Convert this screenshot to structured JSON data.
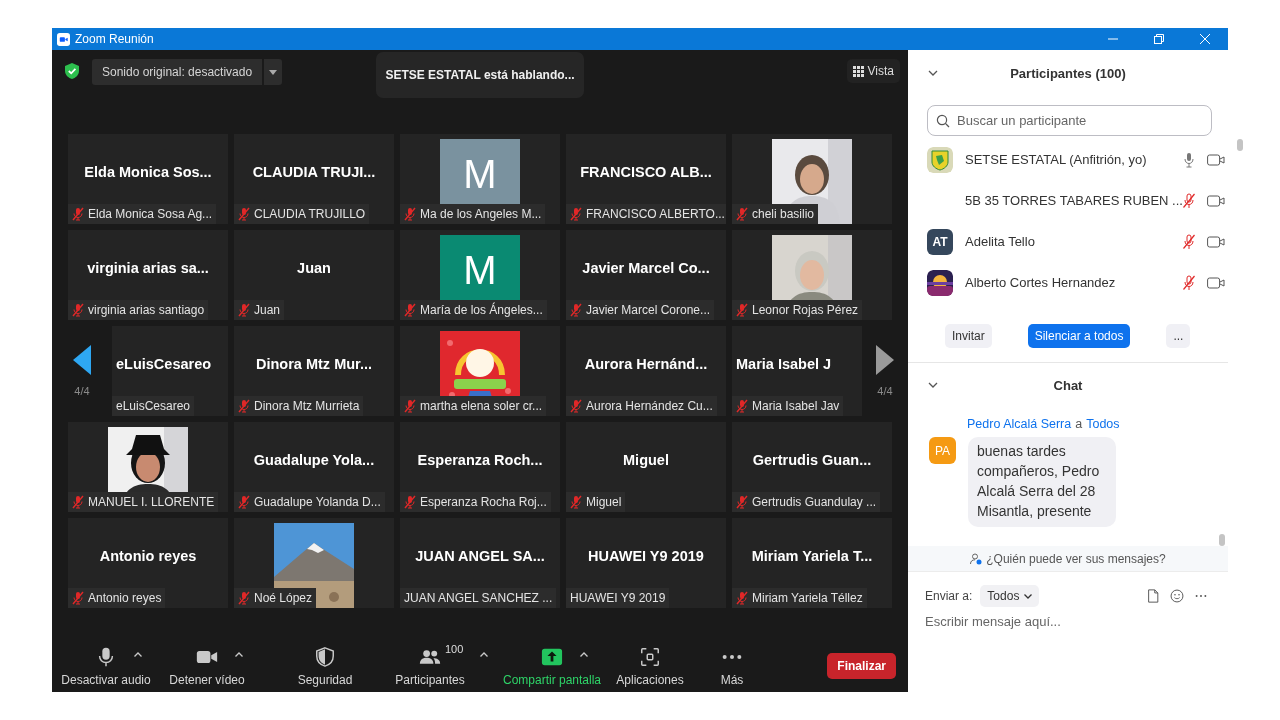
{
  "window": {
    "title": "Zoom Reunión"
  },
  "meeting": {
    "original_sound": "Sonido original: desactivado",
    "speaking": "SETSE ESTATAL está hablando...",
    "view": "Vista"
  },
  "gallery": {
    "prev_page": "4/4",
    "next_page": "4/4",
    "tiles": [
      {
        "kind": "name",
        "title": "Elda Monica Sos...",
        "label": "Elda Monica Sosa Ag...",
        "muted": true
      },
      {
        "kind": "name",
        "title": "CLAUDIA TRUJI...",
        "label": "CLAUDIA TRUJILLO",
        "muted": true
      },
      {
        "kind": "avatar",
        "letter": "M",
        "color": "#7a929f",
        "label": "Ma de los Angeles M...",
        "muted": true
      },
      {
        "kind": "name",
        "title": "FRANCISCO ALB...",
        "label": "FRANCISCO ALBERTO...",
        "muted": true
      },
      {
        "kind": "picture",
        "label": "cheli basilio",
        "muted": true
      },
      {
        "kind": "name",
        "title": "virginia arias sa...",
        "label": "virginia arias santiago",
        "muted": true
      },
      {
        "kind": "name",
        "title": "Juan",
        "label": "Juan",
        "muted": true
      },
      {
        "kind": "avatar",
        "letter": "M",
        "color": "#0a8a72",
        "label": "María de los Ángeles...",
        "muted": true
      },
      {
        "kind": "name",
        "title": "Javier Marcel Co...",
        "label": "Javier Marcel Corone...",
        "muted": true
      },
      {
        "kind": "picture",
        "label": "Leonor Rojas Pérez",
        "muted": true
      },
      {
        "kind": "name",
        "title": "eLuisCesareo",
        "label": "eLuisCesareo",
        "muted": false
      },
      {
        "kind": "name",
        "title": "Dinora Mtz Mur...",
        "label": "Dinora Mtz Murrieta",
        "muted": true
      },
      {
        "kind": "picture",
        "label": "martha elena soler cr...",
        "muted": true
      },
      {
        "kind": "name",
        "title": "Aurora Hernánd...",
        "label": "Aurora Hernández Cu...",
        "muted": true
      },
      {
        "kind": "name",
        "title": "Maria Isabel J",
        "label": "Maria Isabel Jav",
        "muted": true
      },
      {
        "kind": "picture",
        "label": "MANUEL I. LLORENTE",
        "muted": true
      },
      {
        "kind": "name",
        "title": "Guadalupe Yola...",
        "label": "Guadalupe Yolanda D...",
        "muted": true
      },
      {
        "kind": "name",
        "title": "Esperanza Roch...",
        "label": "Esperanza Rocha Roj...",
        "muted": true
      },
      {
        "kind": "name",
        "title": "Miguel",
        "label": "Miguel",
        "muted": true
      },
      {
        "kind": "name",
        "title": "Gertrudis Guan...",
        "label": "Gertrudis Guandulay ...",
        "muted": true
      },
      {
        "kind": "name",
        "title": "Antonio reyes",
        "label": "Antonio reyes",
        "muted": true
      },
      {
        "kind": "picture",
        "label": "Noé López",
        "muted": true
      },
      {
        "kind": "name",
        "title": "JUAN ANGEL SA...",
        "label": "JUAN ANGEL SANCHEZ ...",
        "muted": false
      },
      {
        "kind": "name",
        "title": "HUAWEI Y9 2019",
        "label": "HUAWEI Y9 2019",
        "muted": false
      },
      {
        "kind": "name",
        "title": "Miriam Yariela T...",
        "label": "Miriam Yariela Téllez",
        "muted": true
      }
    ]
  },
  "toolbar": {
    "items": [
      {
        "kind": "mic",
        "label": "Desactivar audio",
        "caret": true
      },
      {
        "kind": "video",
        "label": "Detener vídeo",
        "caret": true
      },
      {
        "kind": "security",
        "label": "Seguridad",
        "caret": false
      },
      {
        "kind": "participants",
        "label": "Participantes",
        "count": "100",
        "caret": true
      },
      {
        "kind": "share",
        "label": "Compartir pantalla",
        "caret": true
      },
      {
        "kind": "apps",
        "label": "Aplicaciones",
        "caret": false
      },
      {
        "kind": "more",
        "label": "Más",
        "caret": false
      }
    ],
    "end": "Finalizar"
  },
  "participants": {
    "title": "Participantes (100)",
    "search_placeholder": "Buscar un participante",
    "items": [
      {
        "kind": "emblem",
        "name": "SETSE ESTATAL (Anfitrión, yo)",
        "muted": false
      },
      {
        "kind": "none",
        "name": "5B 35 TORRES TABARES RUBEN ...",
        "muted": true
      },
      {
        "kind": "initials",
        "initials": "AT",
        "name": "Adelita Tello",
        "muted": true
      },
      {
        "kind": "picture",
        "name": "Alberto Cortes Hernandez",
        "muted": true
      }
    ],
    "buttons": [
      {
        "kind": "plain",
        "label": "Invitar"
      },
      {
        "kind": "primary",
        "label": "Silenciar a todos"
      },
      {
        "kind": "plain",
        "label": "..."
      }
    ]
  },
  "chat": {
    "title": "Chat",
    "messages": [
      {
        "sender": "Pedro Alcalá Serra",
        "to_word": "a",
        "recipient": "Todos",
        "initials": "PA",
        "text": "buenas tardes compañeros, Pedro Alcalá Serra del 28 Misantla, presente"
      }
    ],
    "privacy": "¿Quién puede ver sus mensajes?",
    "send_to_label": "Enviar a:",
    "send_to": "Todos",
    "placeholder": "Escribir mensaje aquí..."
  }
}
